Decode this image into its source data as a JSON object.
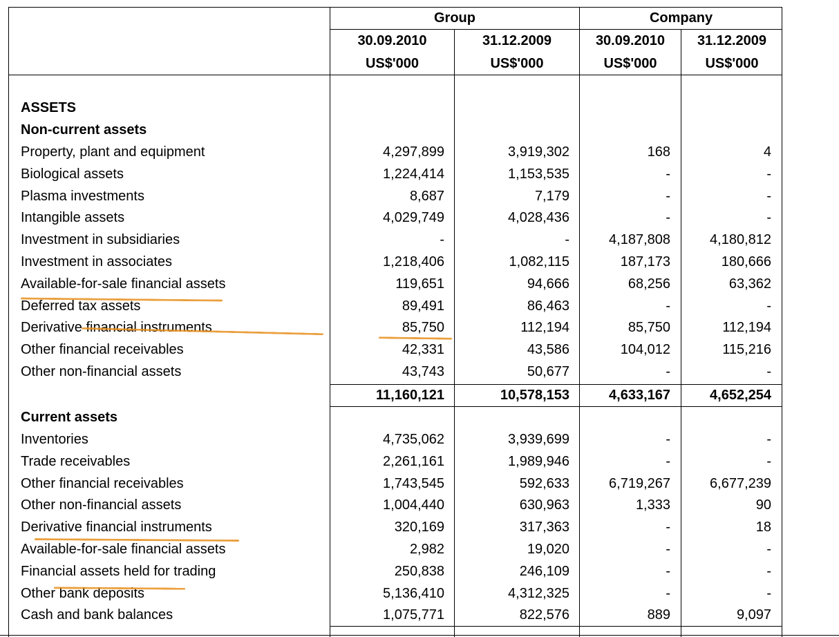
{
  "header": {
    "group_label": "Group",
    "company_label": "Company",
    "columns": [
      {
        "date": "30.09.2010",
        "unit": "US$'000"
      },
      {
        "date": "31.12.2009",
        "unit": "US$'000"
      },
      {
        "date": "30.09.2010",
        "unit": "US$'000"
      },
      {
        "date": "31.12.2009",
        "unit": "US$'000"
      }
    ]
  },
  "assets_label": "ASSETS",
  "non_current": {
    "title": "Non-current assets",
    "rows": [
      {
        "label": "Property, plant and equipment",
        "v": [
          "4,297,899",
          "3,919,302",
          "168",
          "4"
        ]
      },
      {
        "label": "Biological assets",
        "v": [
          "1,224,414",
          "1,153,535",
          "-",
          "-"
        ]
      },
      {
        "label": "Plasma investments",
        "v": [
          "8,687",
          "7,179",
          "-",
          "-"
        ]
      },
      {
        "label": "Intangible assets",
        "v": [
          "4,029,749",
          "4,028,436",
          "-",
          "-"
        ]
      },
      {
        "label": "Investment in subsidiaries",
        "v": [
          "-",
          "-",
          "4,187,808",
          "4,180,812"
        ]
      },
      {
        "label": "Investment in associates",
        "v": [
          "1,218,406",
          "1,082,115",
          "187,173",
          "180,666"
        ]
      },
      {
        "label": "Available-for-sale financial assets",
        "v": [
          "119,651",
          "94,666",
          "68,256",
          "63,362"
        ]
      },
      {
        "label": "Deferred tax assets",
        "v": [
          "89,491",
          "86,463",
          "-",
          "-"
        ]
      },
      {
        "label": "Derivative financial instruments",
        "v": [
          "85,750",
          "112,194",
          "85,750",
          "112,194"
        ]
      },
      {
        "label": "Other financial receivables",
        "v": [
          "42,331",
          "43,586",
          "104,012",
          "115,216"
        ]
      },
      {
        "label": "Other non-financial assets",
        "v": [
          "43,743",
          "50,677",
          "-",
          "-"
        ]
      }
    ],
    "total": [
      "11,160,121",
      "10,578,153",
      "4,633,167",
      "4,652,254"
    ]
  },
  "current": {
    "title": "Current assets",
    "rows": [
      {
        "label": "Inventories",
        "v": [
          "4,735,062",
          "3,939,699",
          "-",
          "-"
        ]
      },
      {
        "label": "Trade receivables",
        "v": [
          "2,261,161",
          "1,989,946",
          "-",
          "-"
        ]
      },
      {
        "label": "Other financial receivables",
        "v": [
          "1,743,545",
          "592,633",
          "6,719,267",
          "6,677,239"
        ]
      },
      {
        "label": "Other non-financial assets",
        "v": [
          "1,004,440",
          "630,963",
          "1,333",
          "90"
        ]
      },
      {
        "label": "Derivative financial instruments",
        "v": [
          "320,169",
          "317,363",
          "-",
          "18"
        ]
      },
      {
        "label": "Available-for-sale financial assets",
        "v": [
          "2,982",
          "19,020",
          "-",
          "-"
        ]
      },
      {
        "label": "Financial assets held for trading",
        "v": [
          "250,838",
          "246,109",
          "-",
          "-"
        ]
      },
      {
        "label": "Other bank deposits",
        "v": [
          "5,136,410",
          "4,312,325",
          "-",
          "-"
        ]
      },
      {
        "label": "Cash and bank balances",
        "v": [
          "1,075,771",
          "822,576",
          "889",
          "9,097"
        ]
      }
    ]
  },
  "colors": {
    "highlight": "#e8901e",
    "rule": "#000000"
  }
}
